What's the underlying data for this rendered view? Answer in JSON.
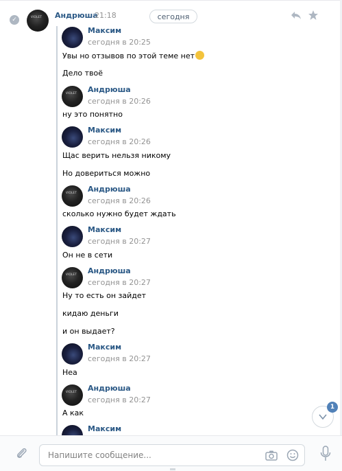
{
  "date_pill": "сегодня",
  "main": {
    "name": "Андрюша",
    "time": "21:18"
  },
  "messages": [
    {
      "author": "Максим",
      "time": "сегодня в 20:25",
      "lines": [
        "Увы но отзывов по этой теме нет",
        "Дело твоё"
      ],
      "emoji_after_first": true
    },
    {
      "author": "Андрюша",
      "time": "сегодня в 20:26",
      "lines": [
        "ну это понятно"
      ]
    },
    {
      "author": "Максим",
      "time": "сегодня в 20:26",
      "lines": [
        "Щас верить нельзя никому",
        "Но довериться можно"
      ]
    },
    {
      "author": "Андрюша",
      "time": "сегодня в 20:26",
      "lines": [
        "сколько нужно будет ждать"
      ]
    },
    {
      "author": "Максим",
      "time": "сегодня в 20:27",
      "lines": [
        "Он не в сети"
      ]
    },
    {
      "author": "Андрюша",
      "time": "сегодня в 20:27",
      "lines": [
        "Ну то есть он зайдет",
        "кидаю деньги",
        "и он выдает?"
      ]
    },
    {
      "author": "Максим",
      "time": "сегодня в 20:27",
      "lines": [
        "Неа"
      ]
    },
    {
      "author": "Андрюша",
      "time": "сегодня в 20:27",
      "lines": [
        "А как"
      ]
    },
    {
      "author": "Максим",
      "time": "",
      "lines": []
    }
  ],
  "scroll_badge": "1",
  "composer": {
    "placeholder": "Напишите сообщение..."
  },
  "icons": {
    "check": "check-icon",
    "reply": "reply-icon",
    "star": "star-icon",
    "attach": "paperclip-icon",
    "camera": "camera-icon",
    "smile": "smile-icon",
    "mic": "microphone-icon",
    "scroll": "chevron-down-icon"
  },
  "colors": {
    "link": "#2a5885",
    "muted": "#939393",
    "accent": "#5181b8"
  }
}
